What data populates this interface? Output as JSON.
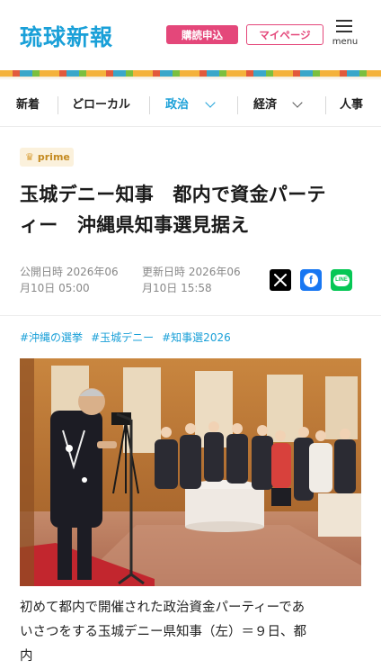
{
  "header": {
    "logo": "琉球新報",
    "subscribe_label": "購読申込",
    "mypage_label": "マイページ",
    "menu_label": "menu",
    "menu_icon": "hamburger-icon"
  },
  "nav": {
    "items": [
      {
        "label": "新着"
      },
      {
        "label": "どローカル"
      },
      {
        "label": "政治",
        "active": true
      },
      {
        "label": "経済"
      },
      {
        "label": "人事"
      }
    ]
  },
  "article": {
    "badge_label": "prime",
    "badge_icon": "crown-icon",
    "title_line1": "玉城デニー知事　都内で資金パーテ",
    "title_line2": "ィー　沖縄県知事選見据え",
    "published_line1": "公開日時 2026年06",
    "published_line2": "月10日 05:00",
    "updated_line1": "更新日時 2026年06",
    "updated_line2": "月10日 15:58",
    "share": {
      "x_icon": "x-icon",
      "facebook_icon": "facebook-icon",
      "line_icon": "line-icon",
      "line_text": "LINE"
    },
    "tags": [
      "#沖縄の選挙",
      "#玉城デニー",
      "#知事選2026"
    ],
    "caption_line1": "初めて都内で開催された政治資金パーティーであ",
    "caption_line2": "いさつをする玉城デニー県知事（左）＝９日、都",
    "caption_line3": "内"
  },
  "colors": {
    "accent": "#1aa0d8",
    "brand_pink": "#e4477a",
    "prime_gold": "#c48a20"
  }
}
